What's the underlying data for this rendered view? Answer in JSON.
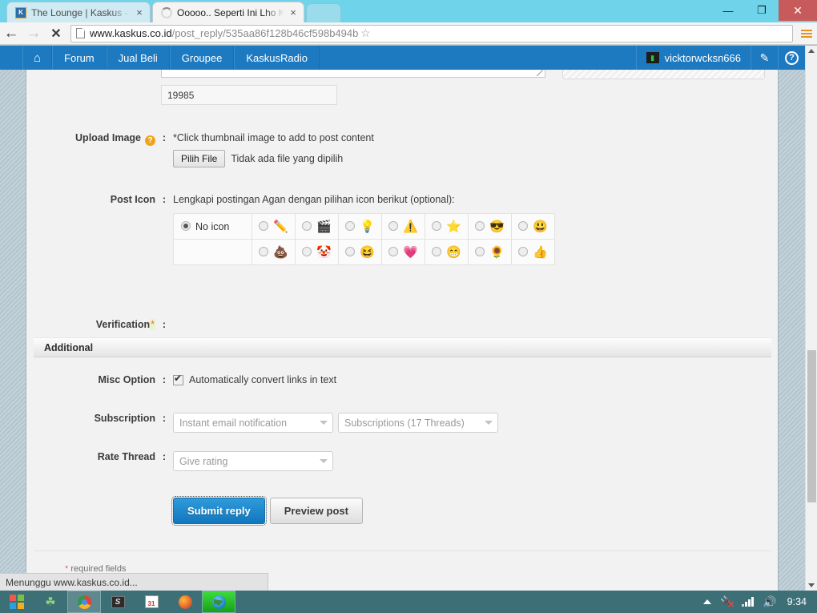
{
  "browser": {
    "tabs": [
      {
        "title": "The Lounge | Kaskus - The",
        "favicon": "kaskus-favicon",
        "close_label": "×",
        "active": false
      },
      {
        "title": "Ooooo.. Seperti Ini Lho KT",
        "favicon": "loading-spinner",
        "close_label": "×",
        "active": true
      }
    ],
    "window_controls": {
      "minimize": "—",
      "maximize": "❐",
      "close": "✕"
    },
    "nav": {
      "back": "←",
      "forward": "→",
      "stop": "✕"
    },
    "omnibox": {
      "host": "www.kaskus.co.id",
      "path": "/post_reply/535aa86f128b46cf598b494b",
      "star": "☆"
    },
    "status_bubble": "Menunggu www.kaskus.co.id..."
  },
  "site_nav": {
    "home_icon": "⌂",
    "items": [
      "Forum",
      "Jual Beli",
      "Groupee",
      "KaskusRadio"
    ],
    "username": "vicktorwcksn666",
    "edit_icon": "✎",
    "help_icon": "?"
  },
  "form": {
    "char_counter": "19985",
    "upload": {
      "label": "Upload Image",
      "help_badge": "?",
      "colon": ":",
      "hint": "*Click thumbnail image to add to post content",
      "file_button": "Pilih File",
      "file_status": "Tidak ada file yang dipilih"
    },
    "post_icon": {
      "label": "Post Icon",
      "colon": ":",
      "hint": "Lengkapi postingan Agan dengan pilihan icon berikut (optional):",
      "no_icon_label": "No icon",
      "row1": [
        "✏️",
        "🎬",
        "💡",
        "⚠️",
        "⭐",
        "😎",
        "😃"
      ],
      "row2": [
        "💩",
        "🤡",
        "😆",
        "💗",
        "😁",
        "🌻",
        "👍"
      ]
    },
    "verification": {
      "label": "Verification",
      "star": "*",
      "colon": ":"
    },
    "additional_header": "Additional",
    "misc": {
      "label": "Misc Option",
      "colon": ":",
      "checkbox_label": "Automatically convert links in text",
      "checked": true
    },
    "subscription": {
      "label": "Subscription",
      "colon": ":",
      "mode_value": "Instant email notification",
      "threads_value": "Subscriptions (17 Threads)"
    },
    "rate_thread": {
      "label": "Rate Thread",
      "colon": ":",
      "value": "Give rating"
    },
    "buttons": {
      "submit": "Submit reply",
      "preview": "Preview post"
    },
    "required_note_star": "*",
    "required_note_text": "required fields"
  },
  "taskbar": {
    "icons": [
      "windows-start-icon",
      "clover-icon",
      "chrome-icon",
      "sublime-icon",
      "calendar-icon",
      "firefox-icon",
      "idm-icon"
    ],
    "tray": {
      "battery": "🔌",
      "volume": "🔊",
      "clock": "9:34"
    }
  },
  "colors": {
    "browser_frame": "#6fd4ea",
    "site_nav": "#1d7ac0",
    "submit_button": "#1277bd",
    "taskbar": "#3d6f77",
    "close_button": "#c75b5b"
  }
}
